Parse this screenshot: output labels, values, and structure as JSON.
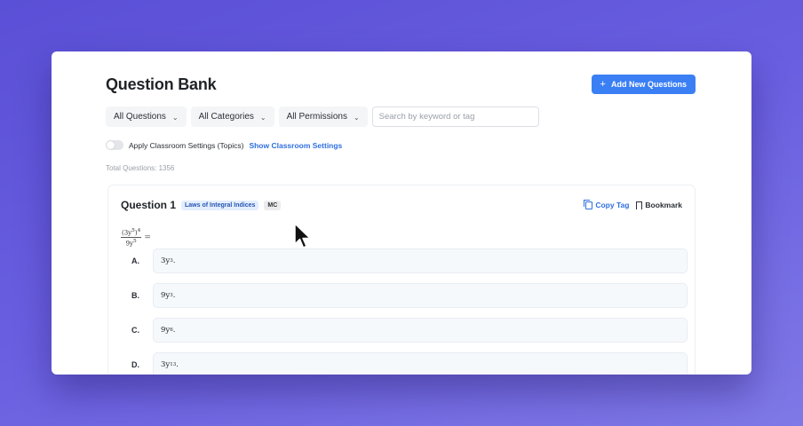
{
  "header": {
    "title": "Question Bank",
    "add_button_label": "Add New Questions"
  },
  "filters": {
    "questions": "All Questions",
    "categories": "All Categories",
    "permissions": "All Permissions",
    "search_placeholder": "Search by keyword or tag"
  },
  "classroom": {
    "toggle_label": "Apply Classroom Settings (Topics)",
    "link_label": "Show Classroom Settings"
  },
  "total_questions": "Total Questions: 1356",
  "question": {
    "title": "Question 1",
    "topic_tag": "Laws of Integral Indices",
    "type_tag": "MC",
    "copy_label": "Copy Tag",
    "bookmark_label": "Bookmark",
    "expr": {
      "num_base": "(3y",
      "num_inner_exp": "5",
      "num_close": ")",
      "num_exp": "4",
      "den_base": "9y",
      "den_exp": "5",
      "equals": "="
    },
    "options": [
      {
        "letter": "A.",
        "coef": "3y",
        "exp": "3",
        "dot": "."
      },
      {
        "letter": "B.",
        "coef": "9y",
        "exp": "3",
        "dot": "."
      },
      {
        "letter": "C.",
        "coef": "9y",
        "exp": "6",
        "dot": "."
      },
      {
        "letter": "D.",
        "coef": "3y",
        "exp": "13",
        "dot": "."
      }
    ]
  },
  "colors": {
    "accent": "#3b7ff5",
    "link": "#2f6fe0",
    "tag_topic_bg": "#e3eeff",
    "background_gradient_start": "#5a4fd6",
    "background_gradient_end": "#7f78e6"
  }
}
